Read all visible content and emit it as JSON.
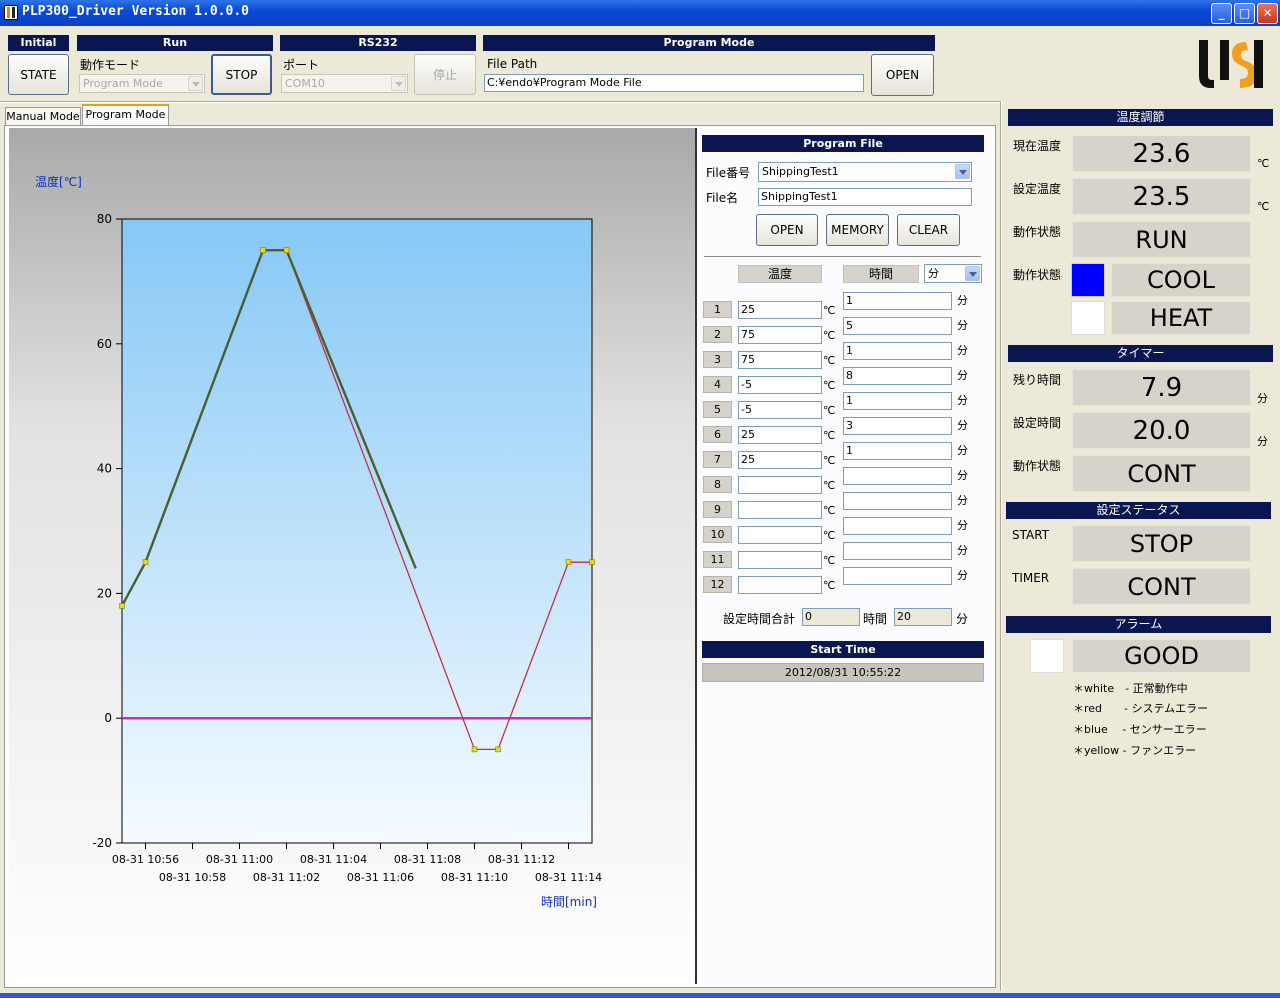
{
  "window": {
    "title": "PLP300_Driver Version 1.0.0.0",
    "minimize": "_",
    "maximize": "□",
    "close": "✕"
  },
  "toolbar": {
    "initial": {
      "header": "Initial",
      "state_button": "STATE"
    },
    "run": {
      "header": "Run",
      "mode_label": "動作モード",
      "mode_value": "Program Mode",
      "stop_button": "STOP"
    },
    "rs232": {
      "header": "RS232",
      "port_label": "ポート",
      "port_value": "COM10",
      "stop_button": "停止"
    },
    "program_mode": {
      "header": "Program Mode",
      "file_path_label": "File Path",
      "file_path": "C:¥endo¥Program Mode File",
      "open_button": "OPEN"
    },
    "logo_icon": "usl-logo"
  },
  "tabs": [
    {
      "label": "Manual Mode",
      "active": false
    },
    {
      "label": "Program Mode",
      "active": true
    }
  ],
  "chart_data": {
    "type": "line",
    "ylabel": "温度[℃]",
    "xlabel": "時間[min]",
    "ylim": [
      -20,
      80
    ],
    "yticks": [
      80,
      60,
      40,
      20,
      0,
      -20
    ],
    "xlim": [
      "08-31 10:55",
      "08-31 11:15"
    ],
    "xticks_row1": [
      "08-31 10:56",
      "08-31 11:00",
      "08-31 11:04",
      "08-31 11:08",
      "08-31 11:12"
    ],
    "xticks_row2": [
      "08-31 10:58",
      "08-31 11:02",
      "08-31 11:06",
      "08-31 11:10",
      "08-31 11:14"
    ],
    "setpoint_series": {
      "points": [
        [
          0.0,
          18
        ],
        [
          1.0,
          25
        ],
        [
          6.0,
          75
        ],
        [
          7.0,
          75
        ],
        [
          15.0,
          -5
        ],
        [
          16.0,
          -5
        ],
        [
          19.0,
          25
        ],
        [
          20.0,
          25
        ]
      ]
    },
    "measured_series": {
      "points": [
        [
          0.0,
          18
        ],
        [
          1.0,
          25
        ],
        [
          6.0,
          75
        ],
        [
          7.0,
          75
        ],
        [
          12.5,
          24
        ]
      ]
    },
    "zero_line": 0,
    "colors": {
      "setpoint": "#c2304a",
      "measured": "#4a5e30",
      "zero": "#e020c8",
      "marker": "#e8d81a"
    }
  },
  "program_file": {
    "header": "Program File",
    "file_no_label": "File番号",
    "file_no_value": "ShippingTest1",
    "file_name_label": "File名",
    "file_name_value": "ShippingTest1",
    "open_button": "OPEN",
    "memory_button": "MEMORY",
    "clear_button": "CLEAR",
    "temp_header": "温度",
    "time_header": "時間",
    "time_unit_select": "分",
    "temp_unit": "℃",
    "time_unit": "分",
    "rows": [
      {
        "no": "1",
        "temp": "25",
        "time": "1"
      },
      {
        "no": "2",
        "temp": "75",
        "time": "5"
      },
      {
        "no": "3",
        "temp": "75",
        "time": "1"
      },
      {
        "no": "4",
        "temp": "-5",
        "time": "8"
      },
      {
        "no": "5",
        "temp": "-5",
        "time": "1"
      },
      {
        "no": "6",
        "temp": "25",
        "time": "3"
      },
      {
        "no": "7",
        "temp": "25",
        "time": "1"
      },
      {
        "no": "8",
        "temp": "",
        "time": ""
      },
      {
        "no": "9",
        "temp": "",
        "time": ""
      },
      {
        "no": "10",
        "temp": "",
        "time": ""
      },
      {
        "no": "11",
        "temp": "",
        "time": ""
      },
      {
        "no": "12",
        "temp": "",
        "time": ""
      }
    ],
    "total_label": "設定時間合計",
    "total_hours": "0",
    "hours_label": "時間",
    "total_minutes": "20",
    "minutes_label": "分",
    "start_header": "Start Time",
    "start_time": "2012/08/31 10:55:22"
  },
  "status": {
    "temp_header": "温度調節",
    "current_temp_label": "現在温度",
    "current_temp": "23.6",
    "current_temp_unit": "℃",
    "set_temp_label": "設定温度",
    "set_temp": "23.5",
    "set_temp_unit": "℃",
    "op_state_label": "動作状態",
    "op_state": "RUN",
    "op_state2_label": "動作状態",
    "cool_label": "COOL",
    "heat_label": "HEAT",
    "cool_color": "#0000ff",
    "heat_color": "#ffffff",
    "timer_header": "タイマー",
    "remaining_label": "残り時間",
    "remaining": "7.9",
    "remaining_unit": "分",
    "set_time_label": "設定時間",
    "set_time": "20.0",
    "set_time_unit": "分",
    "timer_state_label": "動作状態",
    "timer_state": "CONT",
    "setting_header": "設定ステータス",
    "start_label": "START",
    "start_value": "STOP",
    "timer_label": "TIMER",
    "timer_value": "CONT",
    "alarm_header": "アラーム",
    "alarm_color": "#ffffff",
    "alarm_value": "GOOD",
    "legend": [
      "＊white　- 正常動作中",
      "＊red　　- システムエラー",
      "＊blue　 - センサーエラー",
      "＊yellow - ファンエラー"
    ]
  }
}
